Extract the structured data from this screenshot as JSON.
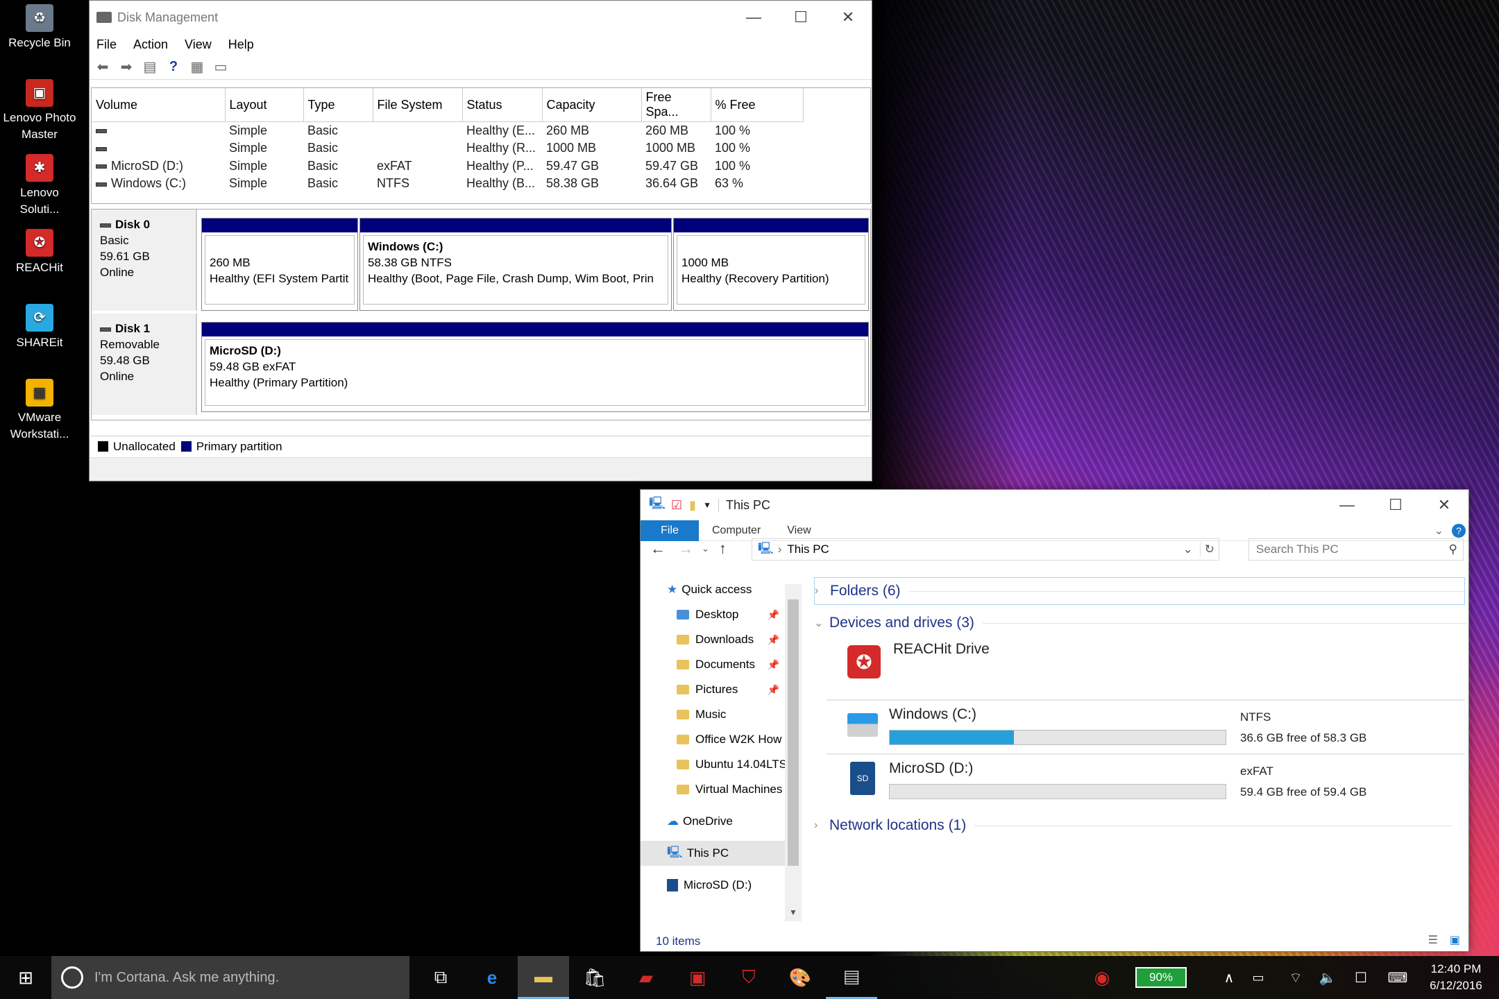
{
  "desktop": {
    "icons": [
      {
        "label": "Recycle Bin",
        "icon": "recycle-bin-icon",
        "color": "#6b7a8a"
      },
      {
        "label": "Lenovo Photo Master",
        "icon": "photo-master-icon",
        "color": "#c8281e"
      },
      {
        "label": "Lenovo Soluti...",
        "icon": "lenovo-solutions-icon",
        "color": "#d42a2a"
      },
      {
        "label": "REACHit",
        "icon": "reachit-icon",
        "color": "#d42a2a"
      },
      {
        "label": "SHAREit",
        "icon": "shareit-icon",
        "color": "#2aa9e0"
      },
      {
        "label": "VMware Workstati...",
        "icon": "vmware-icon",
        "color": "#f2b200"
      }
    ]
  },
  "diskmgmt": {
    "title": "Disk Management",
    "menu": [
      "File",
      "Action",
      "View",
      "Help"
    ],
    "columns": [
      "Volume",
      "Layout",
      "Type",
      "File System",
      "Status",
      "Capacity",
      "Free Spa...",
      "% Free"
    ],
    "rows": [
      [
        "",
        "Simple",
        "Basic",
        "",
        "Healthy (E...",
        "260 MB",
        "260 MB",
        "100 %"
      ],
      [
        "",
        "Simple",
        "Basic",
        "",
        "Healthy (R...",
        "1000 MB",
        "1000 MB",
        "100 %"
      ],
      [
        "MicroSD (D:)",
        "Simple",
        "Basic",
        "exFAT",
        "Healthy (P...",
        "59.47 GB",
        "59.47 GB",
        "100 %"
      ],
      [
        "Windows (C:)",
        "Simple",
        "Basic",
        "NTFS",
        "Healthy (B...",
        "58.38 GB",
        "36.64 GB",
        "63 %"
      ]
    ],
    "disk0": {
      "name": "Disk 0",
      "type": "Basic",
      "size": "59.61 GB",
      "state": "Online",
      "parts": [
        {
          "l1": "",
          "l2": "260 MB",
          "l3": "Healthy (EFI System Partit"
        },
        {
          "l1": "Windows  (C:)",
          "l2": "58.38 GB NTFS",
          "l3": "Healthy (Boot, Page File, Crash Dump, Wim Boot, Prin"
        },
        {
          "l1": "",
          "l2": "1000 MB",
          "l3": "Healthy (Recovery Partition)"
        }
      ]
    },
    "disk1": {
      "name": "Disk 1",
      "type": "Removable",
      "size": "59.48 GB",
      "state": "Online",
      "parts": [
        {
          "l1": "MicroSD  (D:)",
          "l2": "59.48 GB exFAT",
          "l3": "Healthy (Primary Partition)"
        }
      ]
    },
    "legend": {
      "unallocated": "Unallocated",
      "primary": "Primary partition"
    },
    "colors": {
      "primary": "#00007a",
      "unallocated": "#000000"
    }
  },
  "explorer": {
    "title": "This PC",
    "tabs": [
      "File",
      "Computer",
      "View"
    ],
    "address": "This PC",
    "search_placeholder": "Search This PC",
    "nav": {
      "quick_access": "Quick access",
      "items": [
        {
          "label": "Desktop",
          "pinned": true
        },
        {
          "label": "Downloads",
          "pinned": true
        },
        {
          "label": "Documents",
          "pinned": true
        },
        {
          "label": "Pictures",
          "pinned": true
        },
        {
          "label": "Music",
          "pinned": false
        },
        {
          "label": "Office W2K How",
          "pinned": false
        },
        {
          "label": "Ubuntu 14.04LTS",
          "pinned": false
        },
        {
          "label": "Virtual Machines",
          "pinned": false
        }
      ],
      "onedrive": "OneDrive",
      "thispc": "This PC",
      "microsd": "MicroSD (D:)"
    },
    "groups": {
      "folders": "Folders (6)",
      "devices": "Devices and drives (3)",
      "network": "Network locations (1)"
    },
    "reachit": "REACHit Drive",
    "drives": [
      {
        "name": "Windows (C:)",
        "fs": "NTFS",
        "free": "36.6 GB free of 58.3 GB",
        "used_fraction": 0.37
      },
      {
        "name": "MicroSD (D:)",
        "fs": "exFAT",
        "free": "59.4 GB free of 59.4 GB",
        "used_fraction": 0.0
      }
    ],
    "status": "10 items"
  },
  "taskbar": {
    "cortana": "I'm Cortana. Ask me anything.",
    "battery": "90%",
    "time": "12:40 PM",
    "date": "6/12/2016"
  }
}
